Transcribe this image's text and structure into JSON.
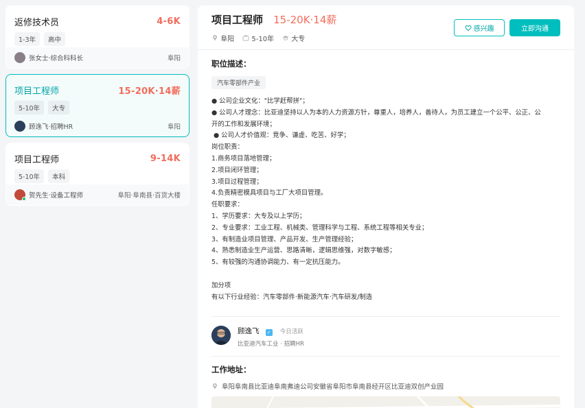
{
  "job_list": [
    {
      "title": "返修技术员",
      "salary": "4-6K",
      "tags": [
        "1-3年",
        "高中"
      ],
      "contact": "张女士·综合科科长",
      "location": "阜阳"
    },
    {
      "title": "项目工程师",
      "salary": "15-20K·14薪",
      "tags": [
        "5-10年",
        "大专"
      ],
      "contact": "顾逸飞·招聘HR",
      "location": "阜阳"
    },
    {
      "title": "项目工程师",
      "salary": "9-14K",
      "tags": [
        "5-10年",
        "本科"
      ],
      "contact": "贺先生·设备工程师",
      "location": "阜阳·阜南县·百货大楼"
    }
  ],
  "detail": {
    "title": "项目工程师",
    "salary": "15-20K·14薪",
    "city": "阜阳",
    "experience": "5-10年",
    "education": "大专",
    "interest_button": "感兴趣",
    "chat_button": "立即沟通",
    "section_desc": "职位描述：",
    "industry_tag": "汽车零部件产业",
    "description_lines": [
      "● 公司企业文化：\"比学赶帮拼\"；",
      "● 公司人才理念：比亚迪坚持以人为本的人力资源方针，尊重人，培养人，善待人，为员工建立一个公平、公正、公",
      "开的工作和发展环境；",
      " ● 公司人才价值观：竞争、谦虚、吃苦、好学；",
      "岗位职责：",
      "1.商务项目落地管理；",
      "2.项目闭环管理；",
      "3.项目过程管理；",
      "4.负责精密模具项目与工厂大项目管理。",
      "任职要求：",
      "1、学历要求：大专及以上学历；",
      "2、专业要求：工业工程、机械类、管理科学与工程、系统工程等相关专业；",
      "3、有制造业项目管理、产品开发、生产管理经验；",
      "4、熟悉制造业生产运营、思路清晰，逻辑思维强，对数字敏感；",
      "5、有较强的沟通协调能力、有一定抗压能力。",
      "",
      "加分项",
      "有以下行业经验：汽车零部件·新能源汽车·汽车研发/制造"
    ],
    "recruiter_name": "顾逸飞",
    "recruiter_status": "今日活跃",
    "recruiter_company": "比亚迪汽车工业 · 招聘HR",
    "section_address": "工作地址：",
    "address": "阜阳阜南县比亚迪阜南弗迪公司安徽省阜阳市阜南县经开区比亚迪双创产业园"
  },
  "colors": {
    "accent": "#00bebd",
    "salary": "#f26d5b"
  }
}
